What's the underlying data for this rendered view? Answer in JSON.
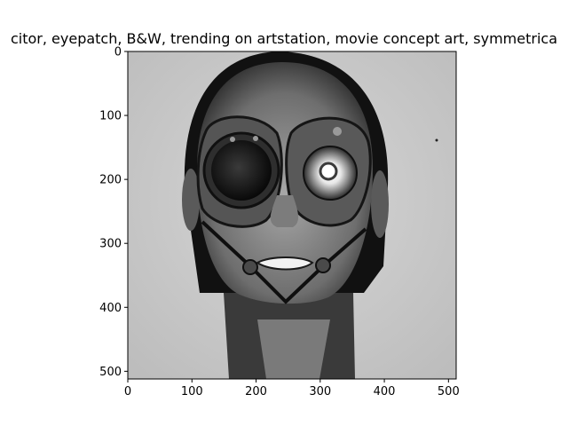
{
  "figure": {
    "title": "citor,  eyepatch, B&W, trending on artstation, movie concept art, symmetrica"
  },
  "chart_data": {
    "type": "image",
    "title": "citor,  eyepatch, B&W, trending on artstation, movie concept art, symmetrica",
    "image_size": [
      512,
      512
    ],
    "x_ticks": [
      0,
      100,
      200,
      300,
      400,
      500
    ],
    "y_ticks": [
      0,
      100,
      200,
      300,
      400,
      500
    ],
    "xlim": [
      0,
      512
    ],
    "ylim": [
      512,
      0
    ],
    "grid": false,
    "colormap": "grayscale",
    "description_subject": "black and white portrait of a face wearing a mechanical mask with one eyepatch lens and one eye"
  },
  "colors": {
    "background": "#ffffff",
    "axes": "#000000",
    "image_bg": "#cfcfcf",
    "ink": "#1a1a1a"
  }
}
